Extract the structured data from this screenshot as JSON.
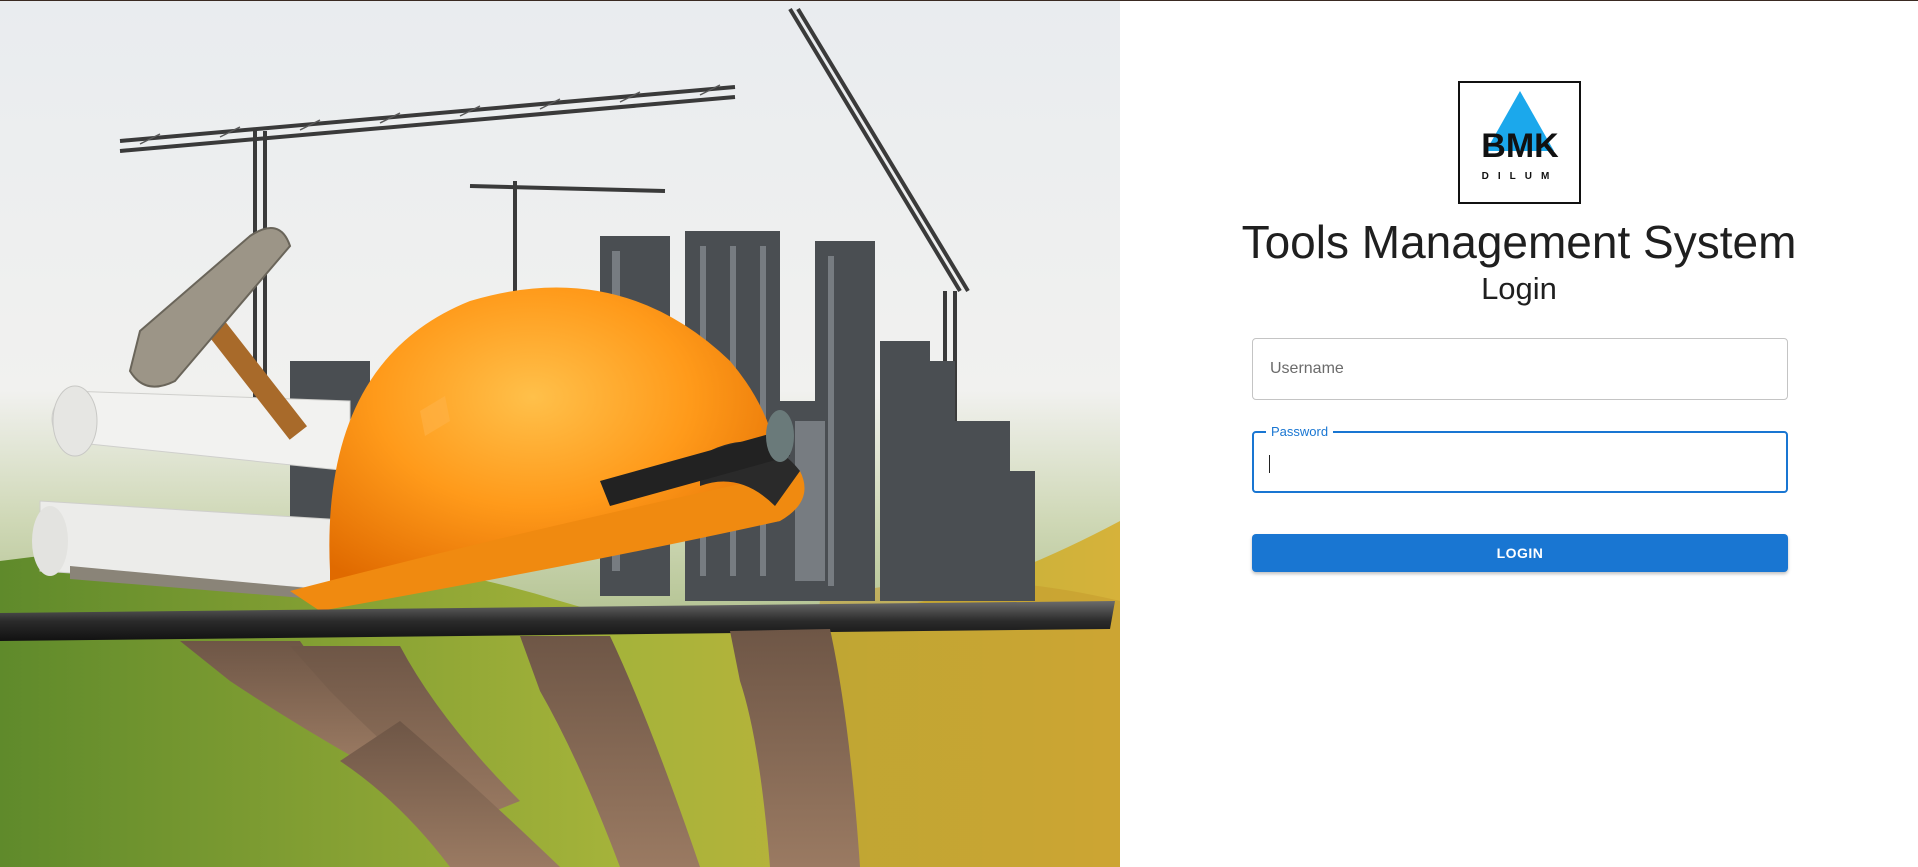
{
  "hero": {
    "image_name": "construction-helmet-hammer-city-illustration"
  },
  "logo": {
    "brand": "BMK",
    "sub": "DILUM",
    "accent_color": "#1ba8ec"
  },
  "header": {
    "title": "Tools Management System",
    "subtitle": "Login"
  },
  "form": {
    "username": {
      "placeholder": "Username",
      "value": ""
    },
    "password": {
      "label": "Password",
      "value": ""
    },
    "submit_label": "LOGIN"
  },
  "colors": {
    "primary": "#1976d2",
    "field_border": "#c4c4c4"
  }
}
